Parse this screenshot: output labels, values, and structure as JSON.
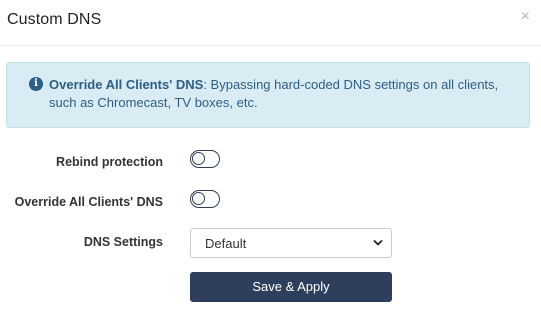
{
  "header": {
    "title": "Custom DNS",
    "close_label": "×"
  },
  "alert": {
    "icon": "info-circle-icon",
    "icon_glyph": "i",
    "strong_text": "Override All Clients' DNS",
    "body_text": ": Bypassing hard-coded DNS settings on all clients, such as Chromecast, TV boxes, etc."
  },
  "form": {
    "rebind_label": "Rebind protection",
    "rebind_enabled": false,
    "override_label": "Override All Clients' DNS",
    "override_enabled": false,
    "dns_label": "DNS Settings",
    "dns_value": "Default"
  },
  "actions": {
    "save_label": "Save & Apply"
  },
  "colors": {
    "primary": "#2d3f5c",
    "alert_bg": "#d9ecf3",
    "alert_text": "#2d5f85"
  }
}
